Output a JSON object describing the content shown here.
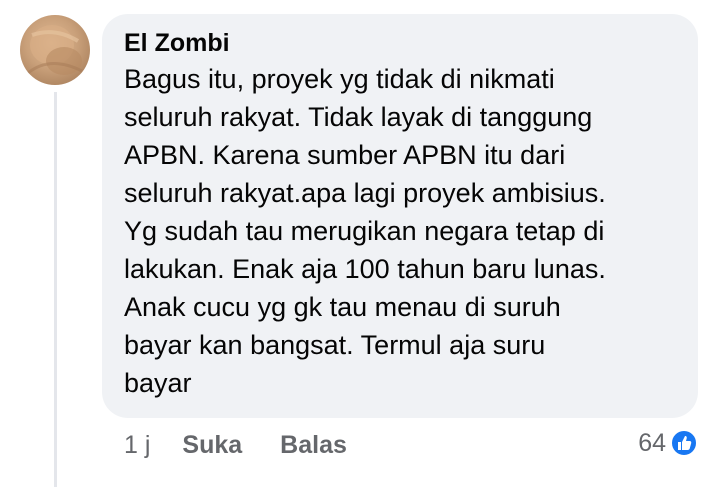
{
  "comment": {
    "author": "El Zombi",
    "text": "Bagus itu, proyek yg tidak di nikmati\nseluruh rakyat. Tidak layak di tanggung\nAPBN. Karena sumber APBN itu dari\nseluruh rakyat.apa lagi proyek ambisius.\nYg sudah tau merugikan negara tetap di\nlakukan. Enak aja 100 tahun baru lunas.\nAnak cucu yg gk tau menau di suruh\nbayar kan bangsat. Termul aja suru\nbayar",
    "time": "1 j",
    "like_label": "Suka",
    "reply_label": "Balas",
    "reaction_count": "64",
    "reaction_icon": "like-icon",
    "colors": {
      "bubble": "#f0f2f5",
      "like_blue": "#1877f2",
      "secondary_text": "#65676b"
    }
  }
}
